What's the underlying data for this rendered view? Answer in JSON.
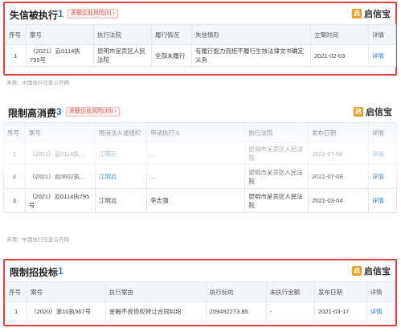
{
  "brand_label": "启信宝",
  "section1": {
    "title": "失信被执行",
    "count": "1",
    "risk_tag": "关联企业风险(1) ›",
    "headers": [
      "序号",
      "案号",
      "执行法院",
      "履行情况",
      "失信情形",
      "立案时间",
      "详情"
    ],
    "rows": [
      [
        "1",
        "（2021）云0114执795号",
        "昆明市呈贡区人民法院",
        "全部未履行",
        "有履行能力而拒不履行生效法律文书确定义务",
        "2021-02-03",
        "详情"
      ]
    ],
    "source": "来源：中国执行信息公开网"
  },
  "section2": {
    "title": "限制高消费",
    "count": "3",
    "risk_tag": "关联企业风险(15) ›",
    "headers": [
      "序号",
      "案号",
      "限消法人或组织",
      "申请执行人",
      "执行法院",
      "发布日期",
      "详情"
    ],
    "rows": [
      [
        "1",
        "（2021）云0114执…",
        "江明云",
        "…",
        "昆明市呈贡区人民法院",
        "2021-07-08",
        "详情"
      ],
      [
        "2",
        "（2021）云0602执…",
        "江明云",
        "…",
        "昆明市呈贡区人民法院",
        "2021-07-08",
        "详情"
      ],
      [
        "3",
        "（2021）云0114执795号",
        "江明云",
        "李志强",
        "昆明市呈贡区人民法院",
        "2021-03-04",
        "详情"
      ]
    ],
    "source": "来源：中国执行信息公开网"
  },
  "section3": {
    "title": "限制招投标",
    "count": "1",
    "headers": [
      "序号",
      "案号",
      "执行案由",
      "执行标的",
      "未执行金额",
      "发布日期",
      "详情"
    ],
    "rows": [
      [
        "1",
        "（2020）浙10执567号",
        "金融不良债权转让合同纠纷",
        "209492273.85",
        "-",
        "2021-03-17",
        "详情"
      ]
    ]
  }
}
